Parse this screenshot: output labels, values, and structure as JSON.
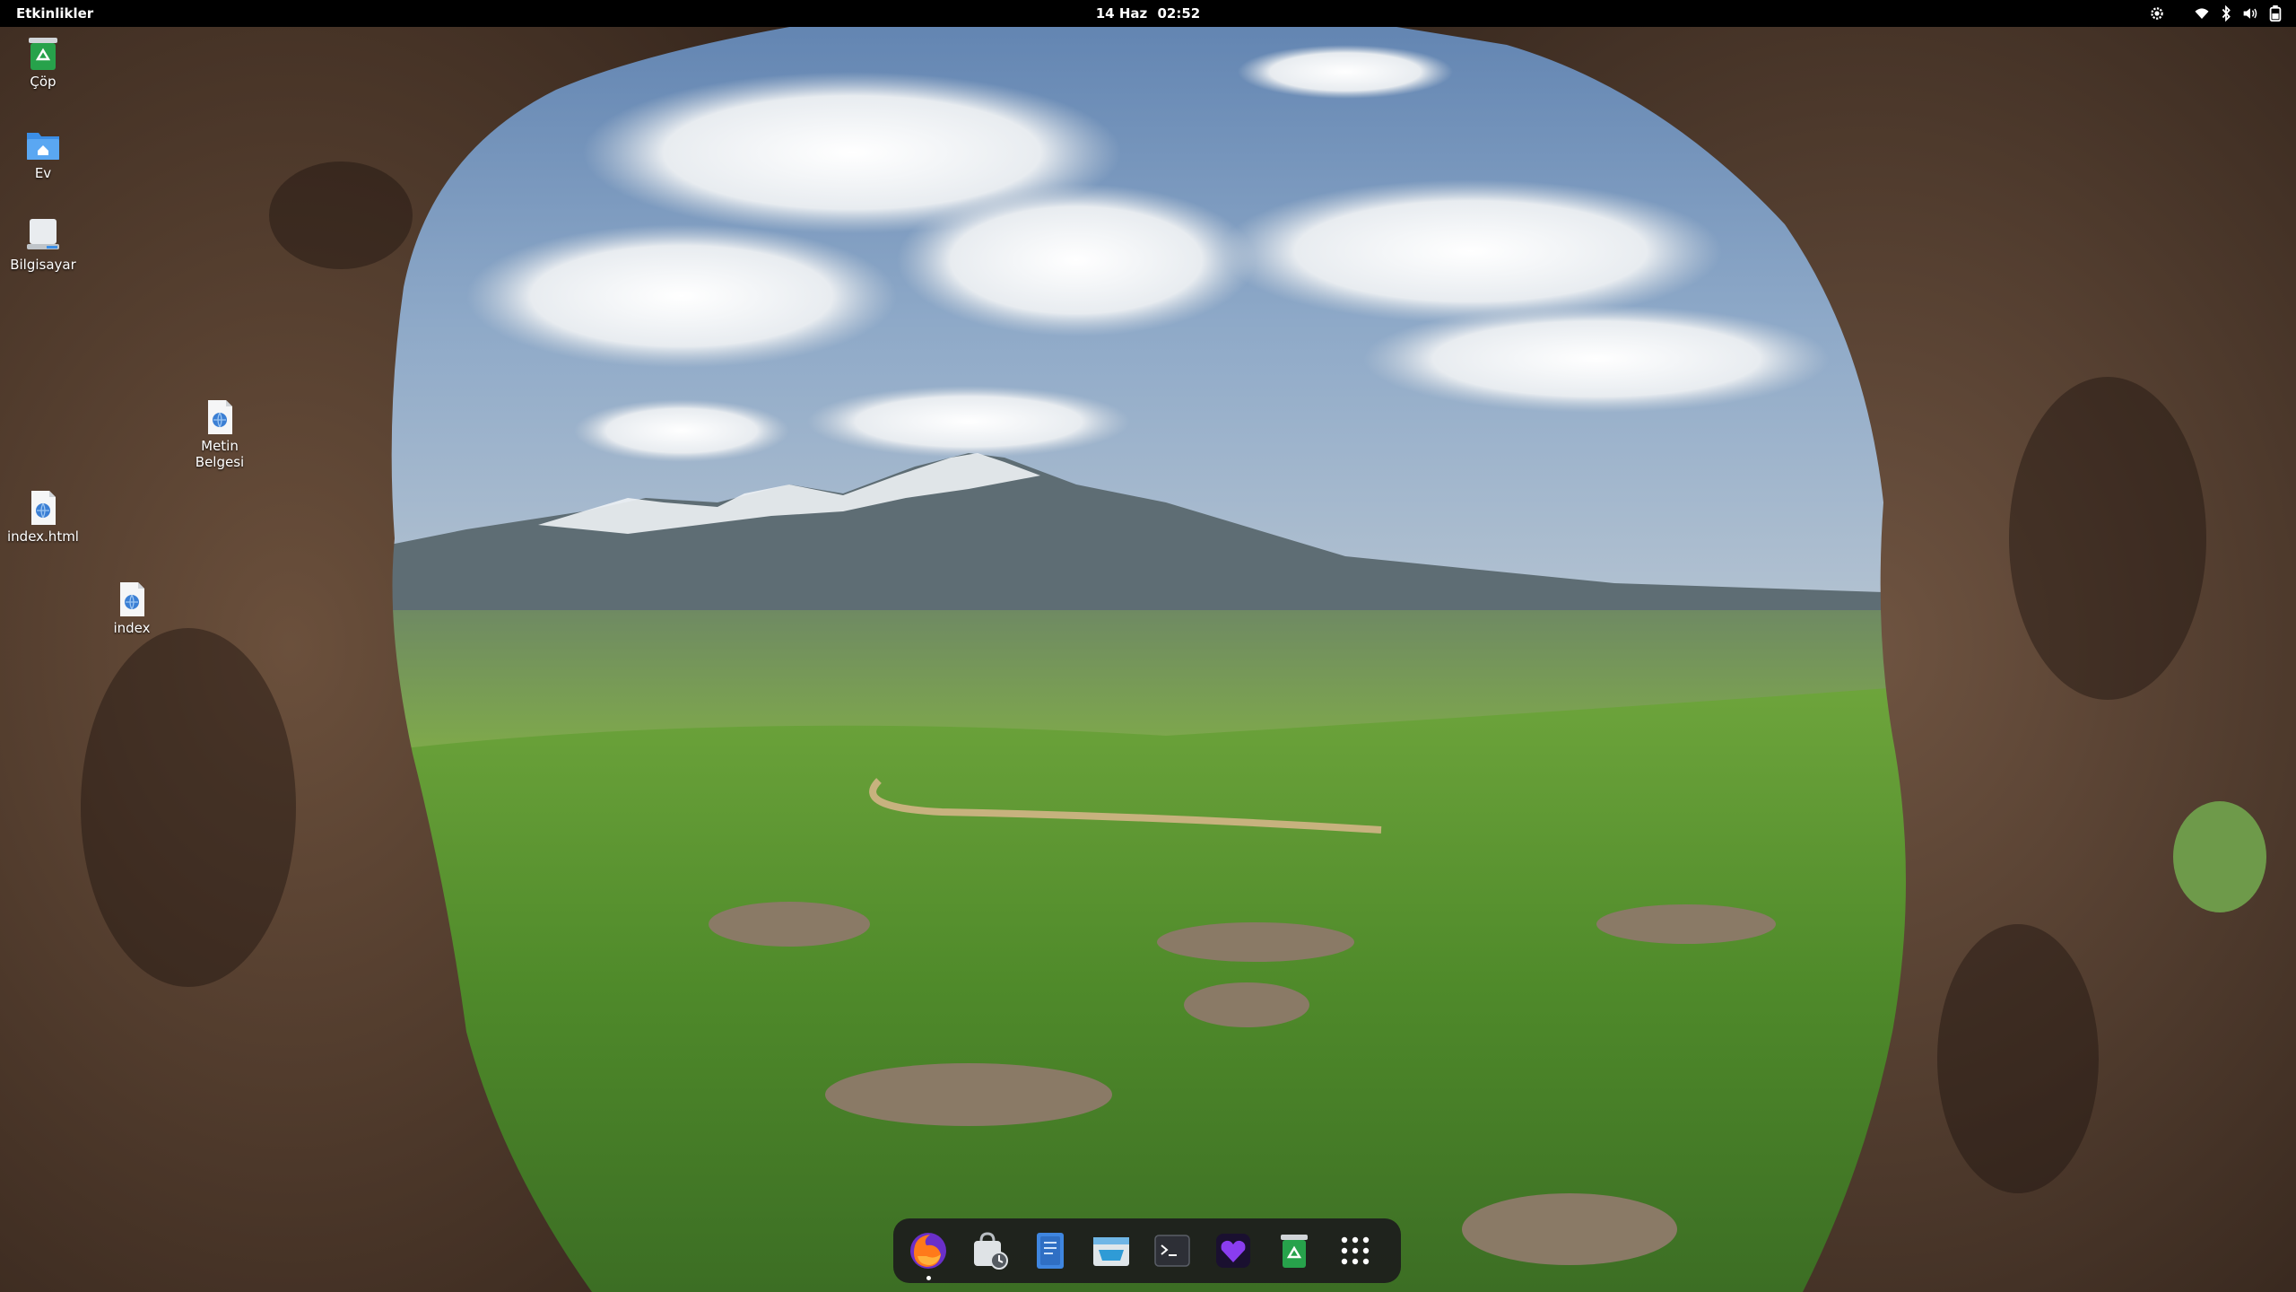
{
  "topbar": {
    "activities_label": "Etkinlikler",
    "date_label": "14 Haz",
    "time_label": "02:52",
    "tray_icons": [
      "settings-icon",
      "wifi-icon",
      "bluetooth-icon",
      "volume-icon",
      "battery-icon"
    ]
  },
  "desktop": {
    "icons": [
      {
        "label": "Çöp",
        "icon": "trash-icon"
      },
      {
        "label": "Ev",
        "icon": "home-folder-icon"
      },
      {
        "label": "Bilgisayar",
        "icon": "computer-icon"
      },
      {
        "label_line1": "Metin",
        "label_line2": "Belgesi",
        "icon": "html-file-icon"
      },
      {
        "label": "index.html",
        "icon": "html-file-icon"
      },
      {
        "label": "index",
        "icon": "html-file-icon"
      }
    ]
  },
  "dock": {
    "items": [
      {
        "name": "firefox",
        "icon": "firefox-icon",
        "running": true
      },
      {
        "name": "software-updater",
        "icon": "software-updater-icon",
        "running": false
      },
      {
        "name": "text-editor",
        "icon": "text-editor-icon",
        "running": false
      },
      {
        "name": "file-manager",
        "icon": "file-manager-icon",
        "running": false
      },
      {
        "name": "terminal",
        "icon": "terminal-icon",
        "running": false
      },
      {
        "name": "health-app",
        "icon": "heart-app-icon",
        "running": false
      },
      {
        "name": "trash",
        "icon": "trash-icon",
        "running": false
      },
      {
        "name": "show-apps",
        "icon": "app-grid-icon",
        "running": false
      }
    ]
  },
  "colors": {
    "topbar_bg": "#000000",
    "dock_bg": "#1c1c1c",
    "sky": "#6f8fb8",
    "grass": "#5c9a2e",
    "rock": "#4a3526"
  }
}
